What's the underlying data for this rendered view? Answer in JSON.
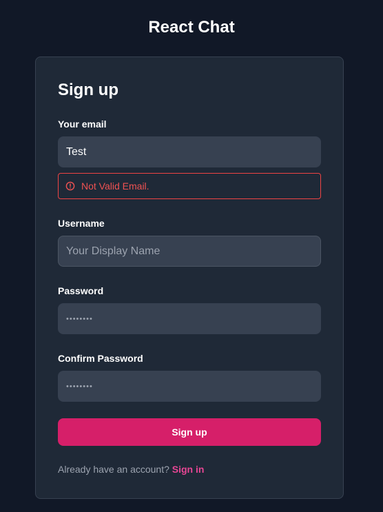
{
  "app": {
    "title": "React Chat"
  },
  "form": {
    "title": "Sign up",
    "email": {
      "label": "Your email",
      "value": "Test",
      "error": "Not Valid Email."
    },
    "username": {
      "label": "Username",
      "placeholder": "Your Display Name"
    },
    "password": {
      "label": "Password",
      "value": "••••••••"
    },
    "confirm_password": {
      "label": "Confirm Password",
      "value": "••••••••"
    },
    "submit_label": "Sign up",
    "footer": {
      "prompt": "Already have an account?",
      "link": "Sign in"
    }
  },
  "colors": {
    "background": "#111827",
    "card": "#1f2937",
    "input": "#374151",
    "error": "#f05252",
    "accent": "#d61f69",
    "link": "#e74694"
  },
  "icons": {
    "error": "exclamation-circle-icon"
  }
}
